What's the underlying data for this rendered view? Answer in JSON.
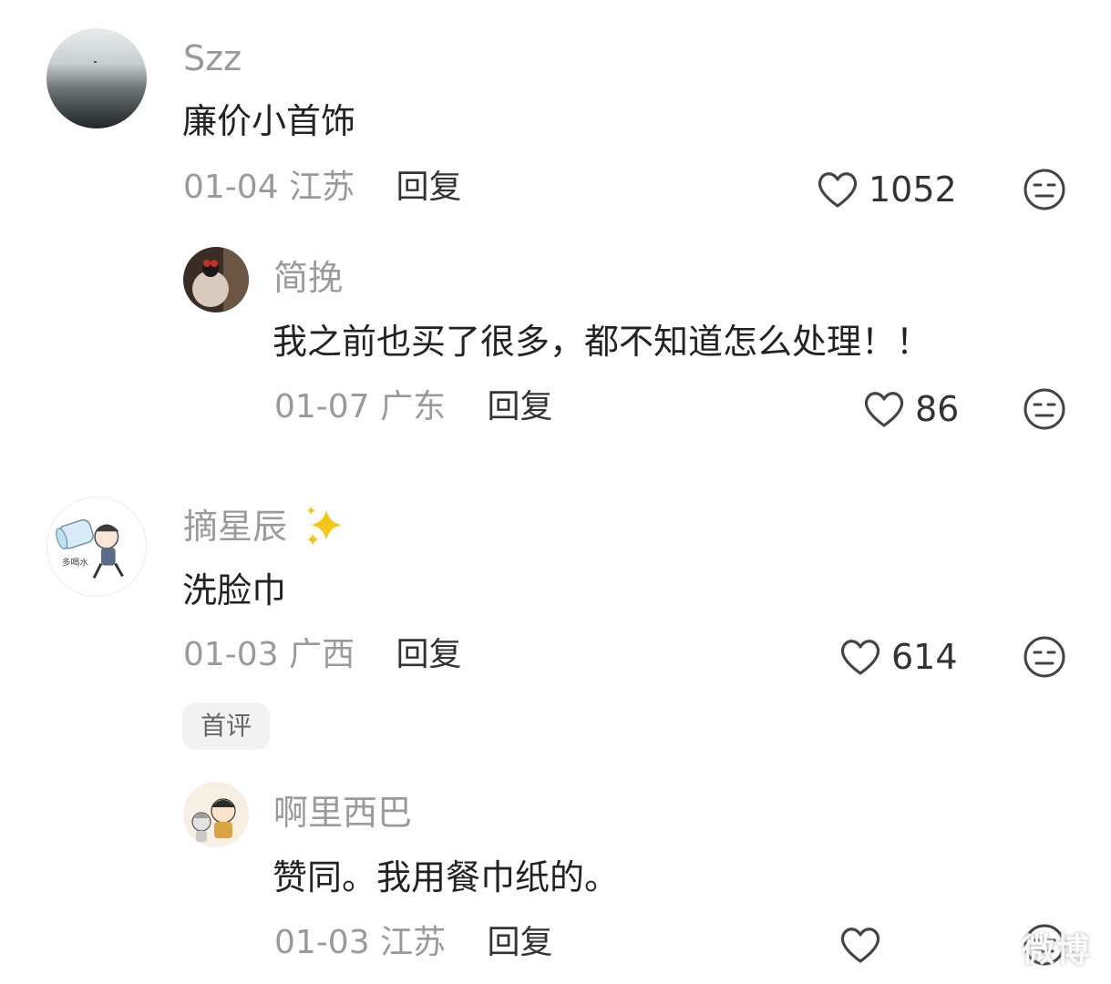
{
  "comments": [
    {
      "user": "Szz",
      "text": "廉价小首饰",
      "date": "01-04",
      "location": "江苏",
      "reply_label": "回复",
      "likes": "1052",
      "replies": [
        {
          "user": "简挽",
          "text": "我之前也买了很多，都不知道怎么处理！！",
          "date": "01-07",
          "location": "广东",
          "reply_label": "回复",
          "likes": "86"
        }
      ]
    },
    {
      "user": "摘星辰",
      "user_emoji": "sparkles-icon",
      "text": "洗脸巾",
      "date": "01-03",
      "location": "广西",
      "reply_label": "回复",
      "likes": "614",
      "badge": "首评",
      "replies": [
        {
          "user": "啊里西巴",
          "text": "赞同。我用餐巾纸的。",
          "date": "01-03",
          "location": "江苏",
          "reply_label": "回复",
          "likes": ""
        }
      ]
    }
  ],
  "watermark": "微博",
  "avatar_text": "多喝水",
  "colors": {
    "username": "#9a9a9a",
    "text": "#222222",
    "meta": "#9a9a9a",
    "badge_bg": "#f2f2f2",
    "sparkle": "#f5c518"
  }
}
